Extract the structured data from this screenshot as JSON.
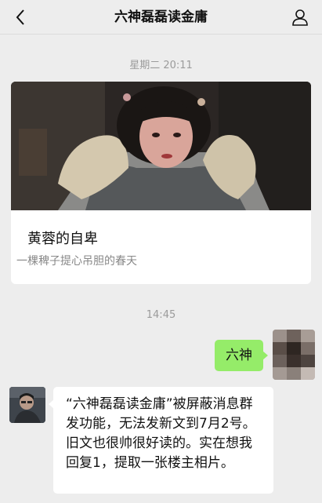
{
  "nav": {
    "title": "六神磊磊读金庸",
    "back_icon": "chevron-left-icon",
    "profile_icon": "person-icon"
  },
  "messages": {
    "time1": "星期二 20:11",
    "article": {
      "title": "黄蓉的自卑",
      "description": "一棵稗子提心吊胆的春天"
    },
    "time2": "14:45",
    "sent": {
      "text": "六神"
    },
    "received": {
      "text": "“六神磊磊读金庸”被屏蔽消息群发功能，无法发新文到7月2号。旧文也很帅很好读的。实在想我回复1，提取一张楼主相片。"
    }
  },
  "colors": {
    "background": "#ededed",
    "sent_bubble": "#95ec69",
    "received_bubble": "#ffffff",
    "timestamp_text": "#9b9b9b"
  }
}
